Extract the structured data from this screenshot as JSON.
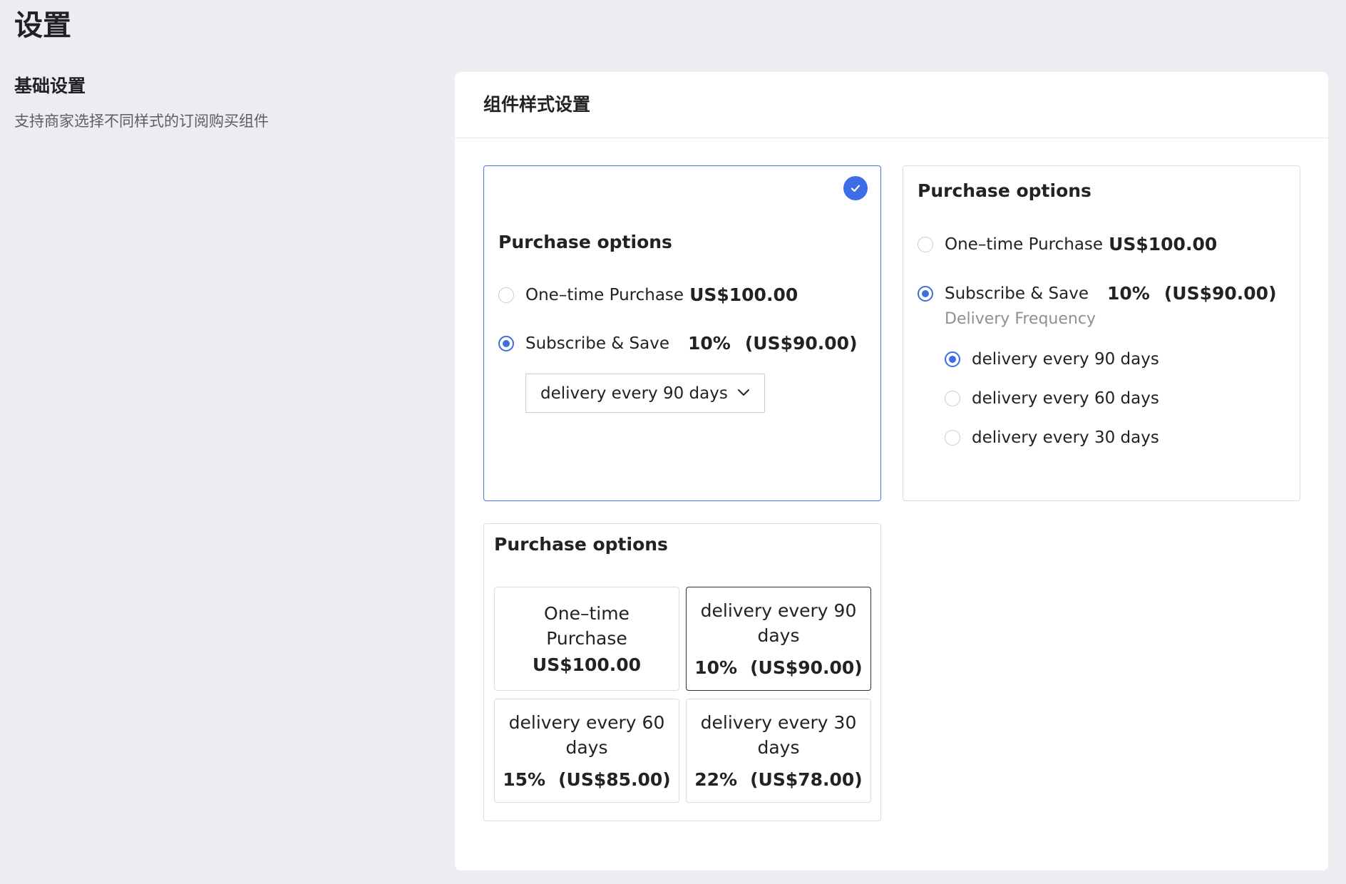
{
  "page": {
    "title": "设置"
  },
  "section": {
    "title": "基础设置",
    "description": "支持商家选择不同样式的订阅购买组件"
  },
  "panel": {
    "title": "组件样式设置"
  },
  "colors": {
    "accent": "#3e6ce4",
    "background": "#ecedf1",
    "card_border": "#dcdde0"
  },
  "style1": {
    "selected": true,
    "check_icon": "check-circle-icon",
    "heading": "Purchase options",
    "one_time": {
      "label": "One–time Purchase",
      "price": "US$100.00"
    },
    "subscribe": {
      "label": "Subscribe & Save",
      "discount": "10%",
      "price": "(US$90.00)"
    },
    "frequency_select": {
      "value": "delivery every 90 days",
      "icon": "chevron-down-icon"
    }
  },
  "style2": {
    "selected": false,
    "heading": "Purchase options",
    "one_time": {
      "label": "One–time Purchase",
      "price": "US$100.00"
    },
    "subscribe": {
      "label": "Subscribe & Save",
      "discount": "10%",
      "price": "(US$90.00)"
    },
    "frequency_label": "Delivery Frequency",
    "frequencies": [
      {
        "label": "delivery every 90 days",
        "checked": true
      },
      {
        "label": "delivery every 60 days",
        "checked": false
      },
      {
        "label": "delivery every 30 days",
        "checked": false
      }
    ]
  },
  "style3": {
    "selected": false,
    "heading": "Purchase options",
    "tiles": [
      {
        "label": "One–time Purchase",
        "value": "US$100.00",
        "active": false
      },
      {
        "label": "delivery every 90 days",
        "discount": "10%",
        "price": "(US$90.00)",
        "active": true
      },
      {
        "label": "delivery every 60 days",
        "discount": "15%",
        "price": "(US$85.00)",
        "active": false
      },
      {
        "label": "delivery every 30 days",
        "discount": "22%",
        "price": "(US$78.00)",
        "active": false
      }
    ]
  }
}
